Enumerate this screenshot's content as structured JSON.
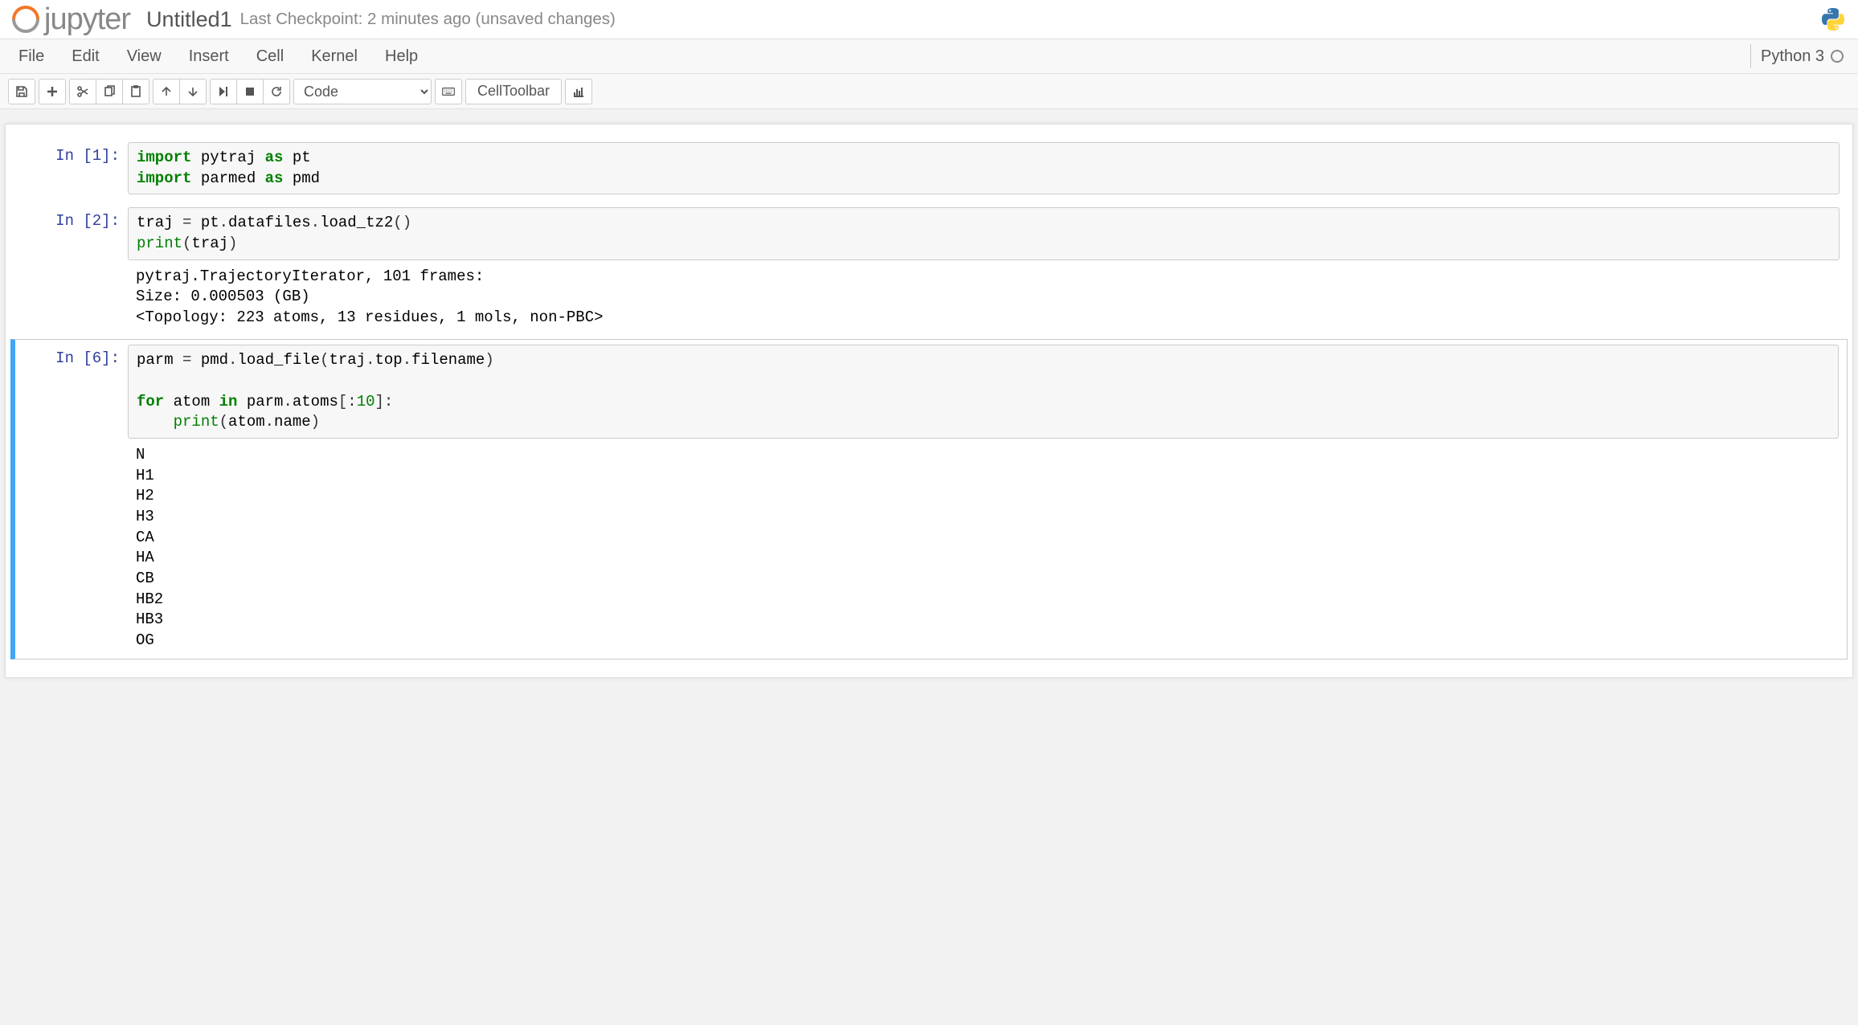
{
  "header": {
    "logo_text": "jupyter",
    "notebook_name": "Untitled1",
    "checkpoint": "Last Checkpoint: 2 minutes ago (unsaved changes)"
  },
  "menubar": {
    "items": [
      "File",
      "Edit",
      "View",
      "Insert",
      "Cell",
      "Kernel",
      "Help"
    ],
    "kernel_name": "Python 3"
  },
  "toolbar": {
    "cell_type": "Code",
    "celltoolbar_label": "CellToolbar"
  },
  "cells": [
    {
      "prompt": "In [1]:",
      "code_tokens": [
        {
          "t": "import ",
          "c": "k"
        },
        {
          "t": "pytraj ",
          "c": ""
        },
        {
          "t": "as ",
          "c": "k"
        },
        {
          "t": "pt",
          "c": ""
        },
        {
          "t": "\n",
          "c": ""
        },
        {
          "t": "import ",
          "c": "k"
        },
        {
          "t": "parmed ",
          "c": ""
        },
        {
          "t": "as ",
          "c": "k"
        },
        {
          "t": "pmd",
          "c": ""
        }
      ],
      "output": ""
    },
    {
      "prompt": "In [2]:",
      "code_tokens": [
        {
          "t": "traj ",
          "c": ""
        },
        {
          "t": "=",
          "c": "op"
        },
        {
          "t": " pt",
          "c": ""
        },
        {
          "t": ".",
          "c": "op"
        },
        {
          "t": "datafiles",
          "c": ""
        },
        {
          "t": ".",
          "c": "op"
        },
        {
          "t": "load_tz2",
          "c": ""
        },
        {
          "t": "()",
          "c": "op"
        },
        {
          "t": "\n",
          "c": ""
        },
        {
          "t": "print",
          "c": "nb"
        },
        {
          "t": "(",
          "c": "op"
        },
        {
          "t": "traj",
          "c": ""
        },
        {
          "t": ")",
          "c": "op"
        }
      ],
      "output": "pytraj.TrajectoryIterator, 101 frames: \nSize: 0.000503 (GB)\n<Topology: 223 atoms, 13 residues, 1 mols, non-PBC>\n"
    },
    {
      "prompt": "In [6]:",
      "selected": true,
      "code_tokens": [
        {
          "t": "parm ",
          "c": ""
        },
        {
          "t": "=",
          "c": "op"
        },
        {
          "t": " pmd",
          "c": ""
        },
        {
          "t": ".",
          "c": "op"
        },
        {
          "t": "load_file",
          "c": ""
        },
        {
          "t": "(",
          "c": "op"
        },
        {
          "t": "traj",
          "c": ""
        },
        {
          "t": ".",
          "c": "op"
        },
        {
          "t": "top",
          "c": ""
        },
        {
          "t": ".",
          "c": "op"
        },
        {
          "t": "filename",
          "c": ""
        },
        {
          "t": ")",
          "c": "op"
        },
        {
          "t": "\n\n",
          "c": ""
        },
        {
          "t": "for ",
          "c": "k"
        },
        {
          "t": "atom ",
          "c": ""
        },
        {
          "t": "in ",
          "c": "k"
        },
        {
          "t": "parm",
          "c": ""
        },
        {
          "t": ".",
          "c": "op"
        },
        {
          "t": "atoms",
          "c": ""
        },
        {
          "t": "[:",
          "c": "op"
        },
        {
          "t": "10",
          "c": "num"
        },
        {
          "t": "]:",
          "c": "op"
        },
        {
          "t": "\n    ",
          "c": ""
        },
        {
          "t": "print",
          "c": "nb"
        },
        {
          "t": "(",
          "c": "op"
        },
        {
          "t": "atom",
          "c": ""
        },
        {
          "t": ".",
          "c": "op"
        },
        {
          "t": "name",
          "c": ""
        },
        {
          "t": ")",
          "c": "op"
        }
      ],
      "output": "N\nH1\nH2\nH3\nCA\nHA\nCB\nHB2\nHB3\nOG"
    }
  ]
}
